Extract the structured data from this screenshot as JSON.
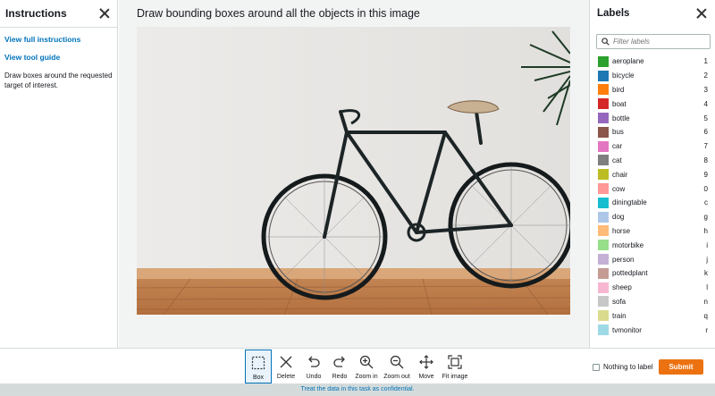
{
  "instructions": {
    "title": "Instructions",
    "links": [
      "View full instructions",
      "View tool guide"
    ],
    "description": "Draw boxes around the requested target of interest."
  },
  "task": {
    "title": "Draw bounding boxes around all the objects in this image"
  },
  "labels_panel": {
    "title": "Labels",
    "filter_placeholder": "Filter labels",
    "items": [
      {
        "name": "aeroplane",
        "key": "1",
        "color": "#2ca02c"
      },
      {
        "name": "bicycle",
        "key": "2",
        "color": "#1f77b4"
      },
      {
        "name": "bird",
        "key": "3",
        "color": "#ff7f0e"
      },
      {
        "name": "boat",
        "key": "4",
        "color": "#d62728"
      },
      {
        "name": "bottle",
        "key": "5",
        "color": "#9467bd"
      },
      {
        "name": "bus",
        "key": "6",
        "color": "#8c564b"
      },
      {
        "name": "car",
        "key": "7",
        "color": "#e377c2"
      },
      {
        "name": "cat",
        "key": "8",
        "color": "#7f7f7f"
      },
      {
        "name": "chair",
        "key": "9",
        "color": "#bcbd22"
      },
      {
        "name": "cow",
        "key": "0",
        "color": "#ff9896"
      },
      {
        "name": "diningtable",
        "key": "c",
        "color": "#17becf"
      },
      {
        "name": "dog",
        "key": "g",
        "color": "#aec7e8"
      },
      {
        "name": "horse",
        "key": "h",
        "color": "#ffbb78"
      },
      {
        "name": "motorbike",
        "key": "i",
        "color": "#98df8a"
      },
      {
        "name": "person",
        "key": "j",
        "color": "#c5b0d5"
      },
      {
        "name": "pottedplant",
        "key": "k",
        "color": "#c49c94"
      },
      {
        "name": "sheep",
        "key": "l",
        "color": "#f7b6d2"
      },
      {
        "name": "sofa",
        "key": "n",
        "color": "#c7c7c7"
      },
      {
        "name": "train",
        "key": "q",
        "color": "#dbdb8d"
      },
      {
        "name": "tvmonitor",
        "key": "r",
        "color": "#9edae5"
      }
    ]
  },
  "toolbar": {
    "tools": [
      {
        "label": "Box",
        "icon": "box-icon"
      },
      {
        "label": "Delete",
        "icon": "delete-icon"
      },
      {
        "label": "Undo",
        "icon": "undo-icon"
      },
      {
        "label": "Redo",
        "icon": "redo-icon"
      },
      {
        "label": "Zoom in",
        "icon": "zoom-in-icon"
      },
      {
        "label": "Zoom out",
        "icon": "zoom-out-icon"
      },
      {
        "label": "Move",
        "icon": "move-icon"
      },
      {
        "label": "Fit image",
        "icon": "fit-image-icon"
      }
    ],
    "nothing_to_label": "Nothing to label",
    "submit": "Submit"
  },
  "footer": {
    "text": "Treat the data in this task as confidential."
  },
  "colors": {
    "accent": "#0073bb",
    "submit": "#ec7211"
  }
}
